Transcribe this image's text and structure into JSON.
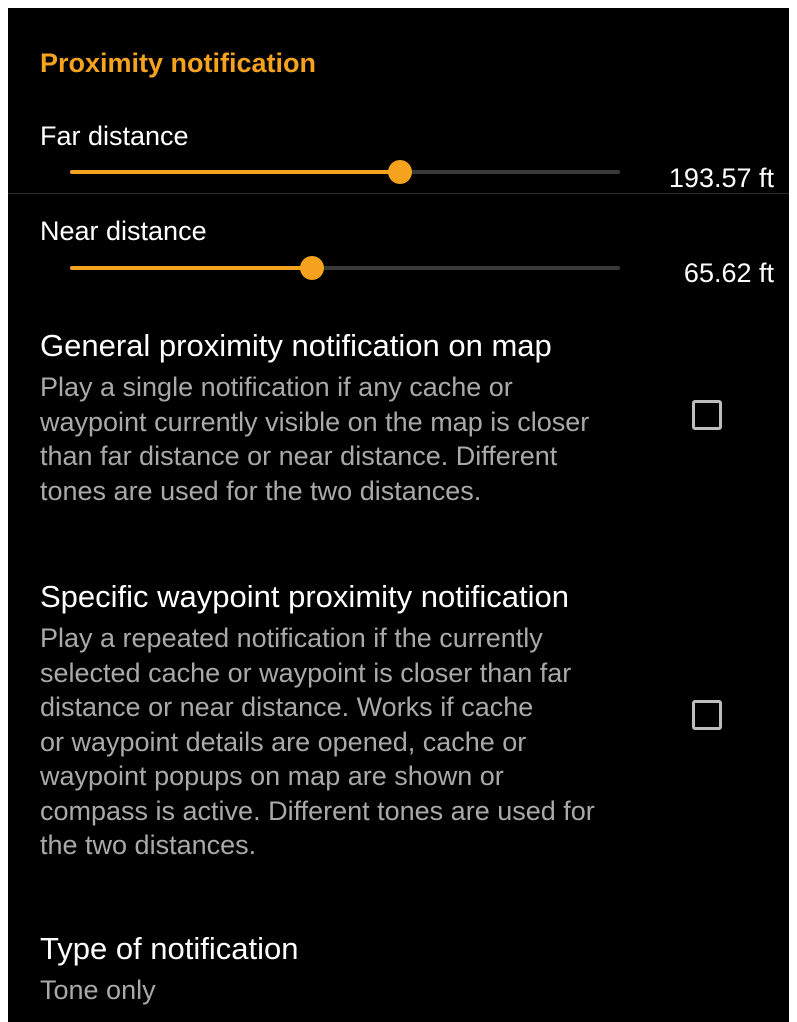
{
  "section": {
    "title": "Proximity notification"
  },
  "far_distance": {
    "title": "Far distance",
    "value": "193.57 ft",
    "slider_fraction": 0.6
  },
  "near_distance": {
    "title": "Near distance",
    "value": "65.62 ft",
    "slider_fraction": 0.44
  },
  "general_proximity": {
    "title": "General proximity notification on map",
    "summary_lines": [
      "Play a single notification if any cache or",
      "waypoint currently visible on the map is closer",
      "than far distance or near distance. Different",
      "tones are used for the two distances."
    ],
    "checked": false
  },
  "specific_proximity": {
    "title": "Specific waypoint proximity notification",
    "summary_lines": [
      "Play a repeated notification if the currently",
      "selected cache or waypoint is closer than far",
      "distance or near distance. Works if cache",
      "or waypoint details are opened, cache or",
      "waypoint popups on map are shown or",
      "compass is active. Different tones are used for",
      "the two distances."
    ],
    "checked": false
  },
  "notification_type": {
    "title": "Type of notification",
    "value": "Tone only"
  },
  "colors": {
    "accent": "#f5a21e",
    "background": "#000000",
    "text_primary": "#ffffff",
    "text_secondary": "#a9a9a9"
  }
}
